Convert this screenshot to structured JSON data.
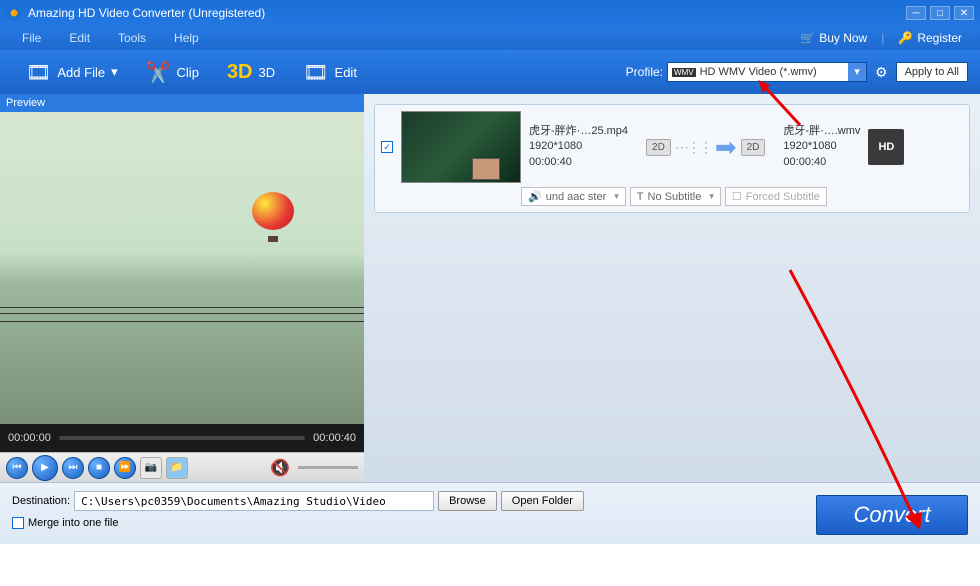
{
  "title": "Amazing HD Video Converter (Unregistered)",
  "menu": {
    "file": "File",
    "edit": "Edit",
    "tools": "Tools",
    "help": "Help"
  },
  "top_links": {
    "buy": "Buy Now",
    "register": "Register"
  },
  "toolbar": {
    "add_file": "Add File",
    "clip": "Clip",
    "three_d": "3D",
    "edit": "Edit",
    "profile_label": "Profile:",
    "profile_value": "HD WMV Video (*.wmv)",
    "apply_all": "Apply to All"
  },
  "preview": {
    "header": "Preview",
    "time_start": "00:00:00",
    "time_end": "00:00:40"
  },
  "item": {
    "source": {
      "name": "虎牙-胖炸·…25.mp4",
      "res": "1920*1080",
      "dur": "00:00:40"
    },
    "output": {
      "name": "虎牙-胖·….wmv",
      "res": "1920*1080",
      "dur": "00:00:40"
    },
    "badge_2d": "2D",
    "hd": "HD",
    "audio": "und aac ster",
    "subtitle": "No Subtitle",
    "forced": "Forced Subtitle"
  },
  "bottom": {
    "dest_label": "Destination:",
    "dest_path": "C:\\Users\\pc0359\\Documents\\Amazing Studio\\Video",
    "browse": "Browse",
    "open_folder": "Open Folder",
    "merge": "Merge into one file",
    "convert": "Convert"
  }
}
